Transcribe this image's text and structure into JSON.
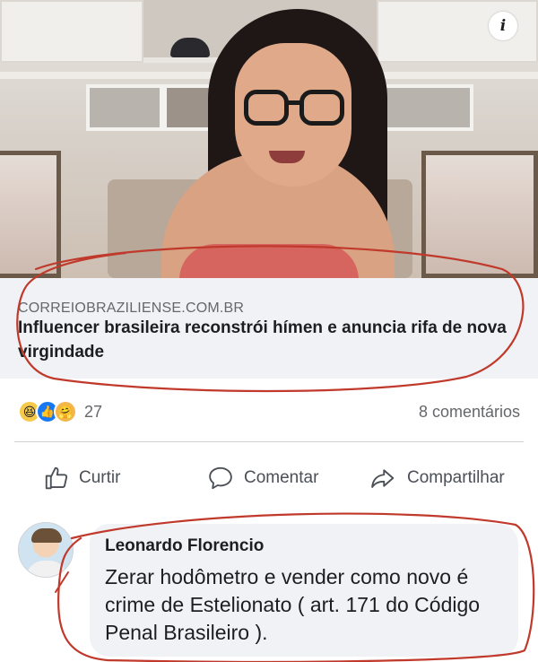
{
  "post": {
    "info_icon": "info-icon",
    "link": {
      "domain": "CORREIOBRAZILIENSE.COM.BR",
      "headline": "Influencer brasileira reconstrói hímen e anuncia rifa de nova virgindade"
    },
    "reactions": {
      "icons": [
        "haha-icon",
        "like-icon",
        "care-icon"
      ],
      "count": "27",
      "comments": "8 comentários"
    },
    "actions": {
      "like": "Curtir",
      "comment": "Comentar",
      "share": "Compartilhar"
    }
  },
  "comment": {
    "author": "Leonardo Florencio",
    "text": "Zerar hodômetro e vender como novo é crime de Estelionato ( art. 171 do Código Penal Brasileiro )."
  },
  "colors": {
    "preview_bg": "#f0f2f5",
    "bubble_bg": "#f0f2f5",
    "secondary_text": "#65676b",
    "annotation_red": "#c0392b",
    "like_blue": "#1877f2"
  }
}
